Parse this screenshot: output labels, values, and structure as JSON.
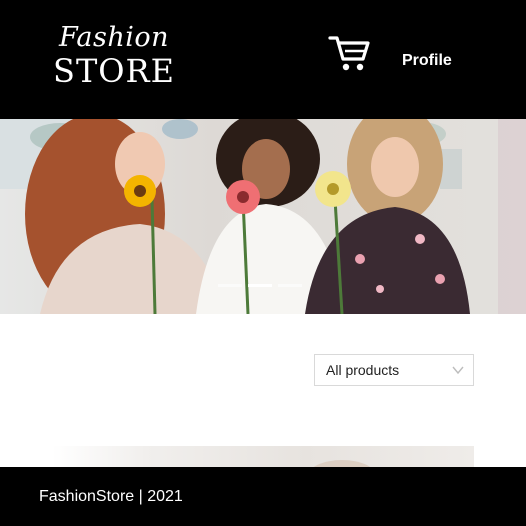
{
  "header": {
    "logo_script": "Fashion",
    "logo_word": "STORE",
    "cart_icon": "shopping-cart-icon",
    "profile_label": "Profile"
  },
  "hero": {
    "image_subject": "three smiling women holding flowers",
    "slide_count": 3,
    "active_slide": 2
  },
  "filter": {
    "selected": "All products",
    "icon": "chevron-down-icon"
  },
  "footer": {
    "text": "FashionStore | 2021"
  },
  "colors": {
    "header_bg": "#000000",
    "footer_bg": "#000000",
    "text_light": "#ffffff",
    "filter_border": "#d9d9d9"
  }
}
